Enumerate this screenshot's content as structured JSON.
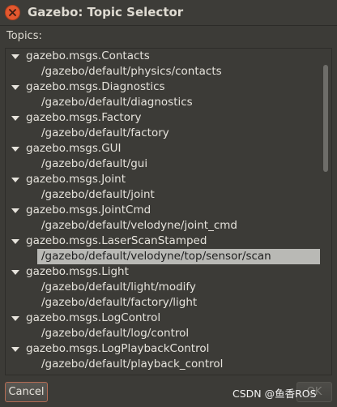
{
  "window": {
    "title": "Gazebo: Topic Selector",
    "close_icon": "close-icon",
    "topics_label": "Topics:"
  },
  "tree": {
    "rows": [
      {
        "kind": "group",
        "text": "gazebo.msgs.Contacts",
        "expanded": true
      },
      {
        "kind": "topic",
        "text": "/gazebo/default/physics/contacts"
      },
      {
        "kind": "group",
        "text": "gazebo.msgs.Diagnostics",
        "expanded": true
      },
      {
        "kind": "topic",
        "text": "/gazebo/default/diagnostics"
      },
      {
        "kind": "group",
        "text": "gazebo.msgs.Factory",
        "expanded": true
      },
      {
        "kind": "topic",
        "text": "/gazebo/default/factory"
      },
      {
        "kind": "group",
        "text": "gazebo.msgs.GUI",
        "expanded": true
      },
      {
        "kind": "topic",
        "text": "/gazebo/default/gui"
      },
      {
        "kind": "group",
        "text": "gazebo.msgs.Joint",
        "expanded": true
      },
      {
        "kind": "topic",
        "text": "/gazebo/default/joint"
      },
      {
        "kind": "group",
        "text": "gazebo.msgs.JointCmd",
        "expanded": true
      },
      {
        "kind": "topic",
        "text": "/gazebo/default/velodyne/joint_cmd"
      },
      {
        "kind": "group",
        "text": "gazebo.msgs.LaserScanStamped",
        "expanded": true
      },
      {
        "kind": "topic",
        "text": "/gazebo/default/velodyne/top/sensor/scan",
        "selected": true
      },
      {
        "kind": "group",
        "text": "gazebo.msgs.Light",
        "expanded": true
      },
      {
        "kind": "topic",
        "text": "/gazebo/default/light/modify"
      },
      {
        "kind": "topic",
        "text": "/gazebo/default/factory/light"
      },
      {
        "kind": "group",
        "text": "gazebo.msgs.LogControl",
        "expanded": true
      },
      {
        "kind": "topic",
        "text": "/gazebo/default/log/control"
      },
      {
        "kind": "group",
        "text": "gazebo.msgs.LogPlaybackControl",
        "expanded": true
      },
      {
        "kind": "topic",
        "text": "/gazebo/default/playback_control"
      }
    ]
  },
  "buttons": {
    "cancel_label": "Cancel",
    "ok_label": "OK"
  },
  "watermark": "CSDN @鱼香ROS",
  "colors": {
    "background": "#3c3b37",
    "close_button": "#e3582f",
    "selection": "#b9b9b5",
    "text": "#e6e3dc"
  }
}
